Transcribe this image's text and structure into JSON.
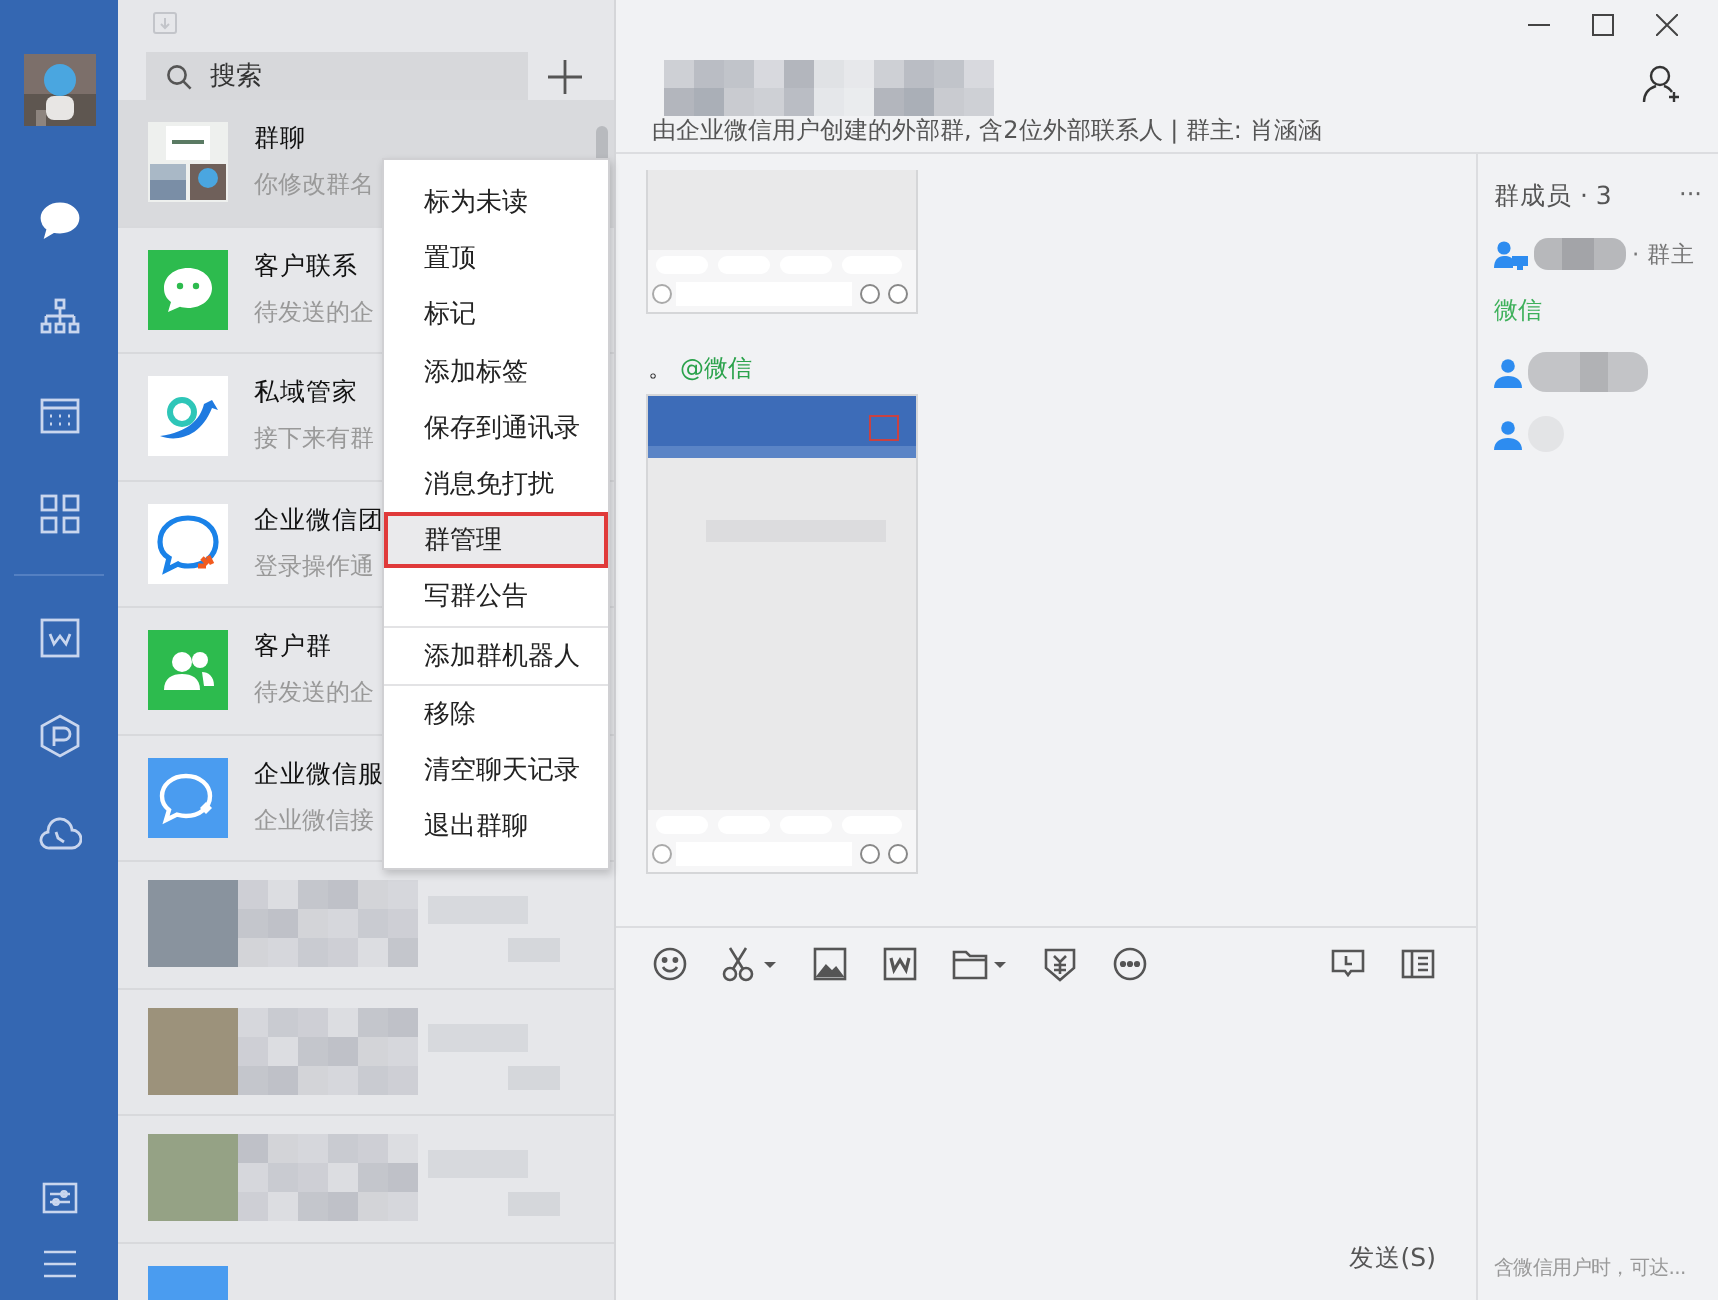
{
  "nav": {
    "items": [
      {
        "kind": "chat",
        "selected": true
      },
      {
        "kind": "org",
        "selected": false
      },
      {
        "kind": "calendar",
        "selected": false
      },
      {
        "kind": "apps",
        "selected": false
      },
      {
        "kind": "doc",
        "selected": false
      },
      {
        "kind": "hexagon",
        "selected": false
      },
      {
        "kind": "cloud",
        "selected": false
      }
    ],
    "bottom": [
      {
        "kind": "settings"
      },
      {
        "kind": "menu"
      }
    ]
  },
  "chat_list": {
    "search": {
      "placeholder": "搜索"
    },
    "items": [
      {
        "kind": "group",
        "name": "群聊",
        "preview": "你修改群名",
        "selected": true
      },
      {
        "kind": "wechat",
        "name": "客户联系",
        "preview": "待发送的企",
        "selected": false
      },
      {
        "kind": "bird",
        "name": "私域管家",
        "preview": "接下来有群",
        "selected": false
      },
      {
        "kind": "bubble",
        "name": "企业微信团",
        "preview": "登录操作通",
        "selected": false
      },
      {
        "kind": "people",
        "name": "客户群",
        "preview": "待发送的企",
        "selected": false
      },
      {
        "kind": "service",
        "name": "企业微信服",
        "preview": "企业微信接",
        "selected": false
      },
      {
        "kind": "blurred",
        "selected": false
      },
      {
        "kind": "blurred",
        "selected": false
      },
      {
        "kind": "blurred",
        "selected": false
      },
      {
        "kind": "meeting",
        "selected": false
      }
    ]
  },
  "context_menu": {
    "groups": [
      [
        {
          "label": "标为未读",
          "selected": false
        },
        {
          "label": "置顶",
          "selected": false
        },
        {
          "label": "标记",
          "selected": false
        },
        {
          "label": "添加标签",
          "selected": false
        },
        {
          "label": "保存到通讯录",
          "selected": false
        },
        {
          "label": "消息免打扰",
          "selected": false
        },
        {
          "label": "群管理",
          "selected": true
        },
        {
          "label": "写群公告",
          "selected": false
        }
      ],
      [
        {
          "label": "添加群机器人",
          "selected": false
        }
      ],
      [
        {
          "label": "移除",
          "selected": false
        },
        {
          "label": "清空聊天记录",
          "selected": false
        },
        {
          "label": "退出群聊",
          "selected": false
        }
      ]
    ]
  },
  "chat": {
    "subtitle": "由企业微信用户创建的外部群, 含2位外部联系人 | 群主: 肖涵涵",
    "messages": [
      {
        "kind": "screenshot",
        "cropped": true
      },
      {
        "kind": "mention",
        "dot": "。",
        "mention": "@微信"
      },
      {
        "kind": "screenshot",
        "cropped": false
      }
    ],
    "send": "发送(S)"
  },
  "members": {
    "title": "群成员 · 3",
    "more": "···",
    "owner_tag": "· 群主",
    "section": "微信",
    "hint": "含微信用户时，可达..."
  }
}
